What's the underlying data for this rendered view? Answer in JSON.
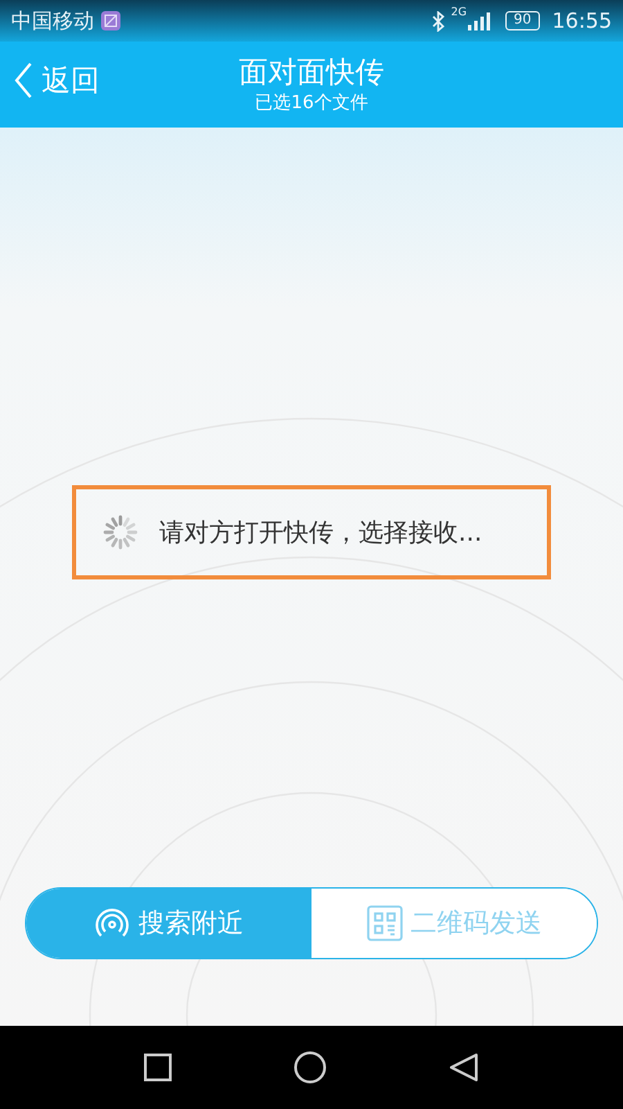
{
  "status_bar": {
    "carrier": "中国移动",
    "network": "2G",
    "battery": "90",
    "time": "16:55"
  },
  "header": {
    "back": "返回",
    "title": "面对面快传",
    "subtitle": "已选16个文件"
  },
  "message": {
    "text": "请对方打开快传，选择接收...",
    "highlighted": true
  },
  "tabs": [
    {
      "label": "搜索附近",
      "kind": "nearby",
      "selected": true
    },
    {
      "label": "二维码发送",
      "kind": "qrcode",
      "selected": false
    }
  ]
}
